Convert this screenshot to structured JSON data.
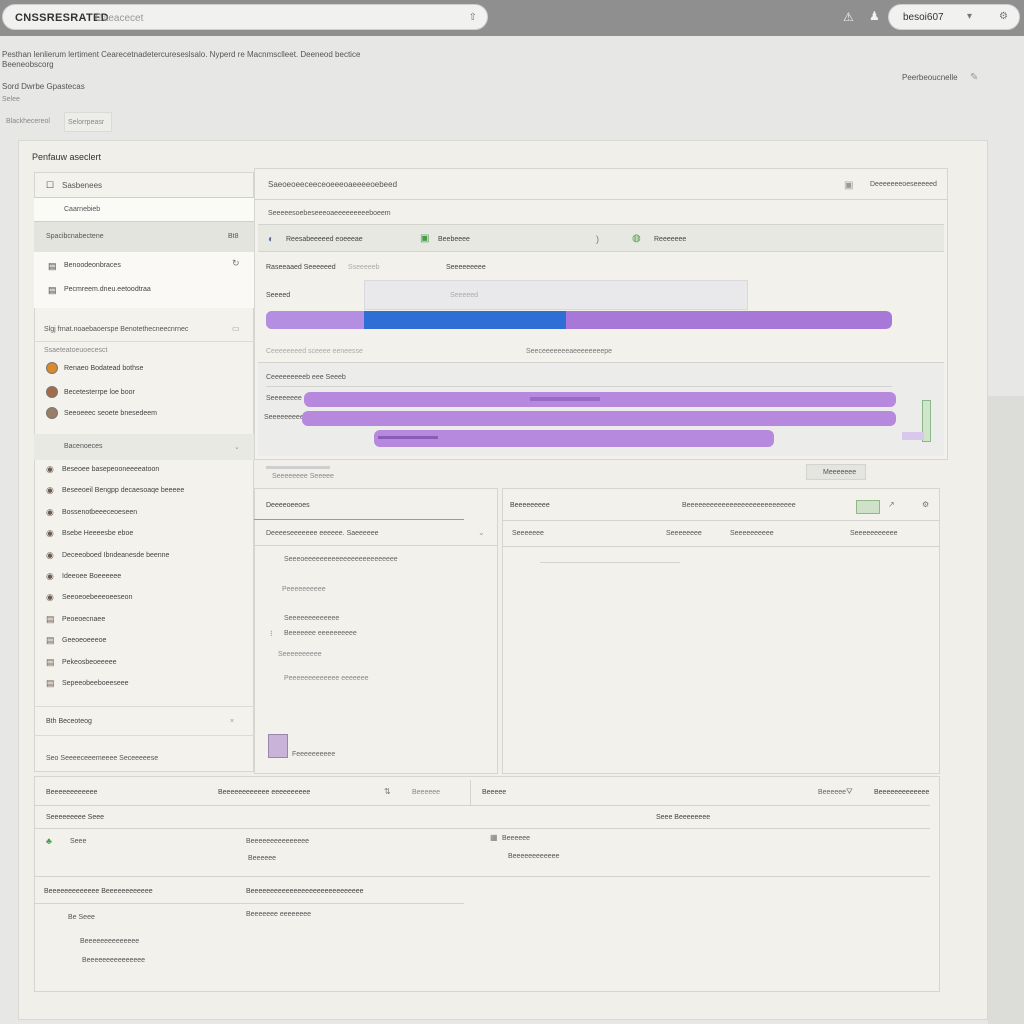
{
  "topbar": {
    "brand": "CNSSRESRATED",
    "search_placeholder": "Gaeacecet",
    "search_hint": "⇧",
    "user": "besoi607"
  },
  "header": {
    "line1": "Pesthan lenlierum lertiment Cearecetnadetercureseslsalo. Nyperd re Macnmsclleet. Deeneod bectice",
    "line2": "Beeneobscorg",
    "line3": "Sord Dwrbe Gpastecas",
    "line4": "Selee",
    "line5": "Blackhecereol",
    "line6": "Selorrpeasr",
    "right_link": "Peerbeoucnelle"
  },
  "panel": {
    "title": "Penfauw aseclert"
  },
  "sidebar": {
    "title": "Sasbenees",
    "tab": "Caarnebieb",
    "group1": {
      "label": "Spacibcnabectene",
      "badge": "Bt8",
      "items": [
        "Benoodeonbraces",
        "Pecmreem.dneu.eetoodtraa"
      ]
    },
    "group2": {
      "label": "Slgj frnat.noaebaoerspe Benotethecneecnrnec",
      "sub": "Ssaeteatoeuoecesct",
      "items": [
        "Renaeo Bodatead bothse",
        "Becetesterrpe loe boor",
        "Seeoeeec seoete bnesedeem"
      ]
    },
    "group3": {
      "label": "Bacenoeces",
      "items": [
        "Beseoee basepeooneeeeatoon",
        "Beseeoeil Bengpp decaesoaqe beeeee",
        "Bossenotbeeeceoeseen",
        "Bsebe Heeeesbe eboe",
        "Deceeoboed Ibndeanesde beenne",
        "Ideeoee Boeeeeee",
        "Seeoeoebeeeoeeseon",
        "Peoeoecnaee",
        "Geeoeoeeeoe",
        "Pekeosbeoeeeee",
        "Sepeeobeeboeeseee"
      ]
    },
    "footer1": "Bth Beceoteog",
    "footer2": "Seo Seeeeceeemeeee Seceeeeese"
  },
  "main": {
    "breadcrumb": "Saeoeoeeceeceoeeeoaeeeeoebeed",
    "right_action": "Deeeeeeeoeseeeeed",
    "subheader": "Seeeeesoebeseeeoaeeeeeeeeeboeem",
    "tabs": [
      "Reesabeeeeed eoeeeae",
      "Beebeeee",
      "Reeeeeee"
    ],
    "stats": {
      "label_a": "Raseeaaed Seeeeeed",
      "label_b": "Sseeeeeb",
      "label_c": "Seeeeeeeee",
      "sub_a": "Seeeed",
      "sub_b": "Seeeeed"
    },
    "bar_caption": "Ceeeeeeeed sceeee eeneesse",
    "bar_caption_right": "Seeceeeeeeeaeeeeeeeepe",
    "section2": "Ceeeeeeeeeb eee Seeeb",
    "row_labels": [
      "Seeeeeeee",
      "Seeeeeeeee"
    ],
    "foot_left": "Seeeeeeee Seeeee",
    "foot_right": "Meeeeeee"
  },
  "lower_left": {
    "title": "Deeeeoeeoes",
    "sub": "Deeeeseeeeeee eeeeee. Saeeeeee",
    "lines": [
      "Seeeoeeeeeeeeeeeeeeeeeeeeeeee",
      "Peeeeeeeeee",
      "Seeeeeeeeeeeee",
      "Beeeeeee eeeeeeeeee",
      "Seeeeeeeeee",
      "Peeeeeeeeeeeee eeeeeee",
      "Feeeeeeeeee"
    ]
  },
  "lower_right": {
    "title": "Beeeeeeeee",
    "center": "Beeeeeeeeeeeeeeeeeeeeeeeeeeee",
    "col1": "Seeeeeee",
    "col2": "Seeeeeeee",
    "col3": "Seeeeeeeeee",
    "col4": "Seeeeeeeeeee"
  },
  "bottom": {
    "h1": "Beeeeeeeeeeee",
    "h2": "Beeeeeeeeeeee eeeeeeeeee",
    "h3": "Beeeeee",
    "h4": "Beeeee",
    "h5": "Beeeeeeeeeeeee",
    "r1": "Seeeeeeeee Seee",
    "r2": "Seee Beeeeeeee",
    "items_left": [
      "Seee",
      "Beeeeeeeeeeeeeee",
      "Beeeeee"
    ],
    "items_right": [
      "Beeeeee",
      "Beeeeeeeeeeee"
    ],
    "h6": "Beeeeeeeeeeeee Beeeeeeeeeeee",
    "h7": "Beeeeeeeeeeeeeeeeeeeeeeeeeeeee",
    "rows": [
      "Be Seee",
      "Beeeeeee eeeeeeee",
      "Beeeeeeeeeeeeee",
      "Beeeeeeeeeeeeeee"
    ]
  },
  "colors": {
    "purple": "#a878d8",
    "blue": "#2f6ed4",
    "green": "#4a9a4a"
  }
}
